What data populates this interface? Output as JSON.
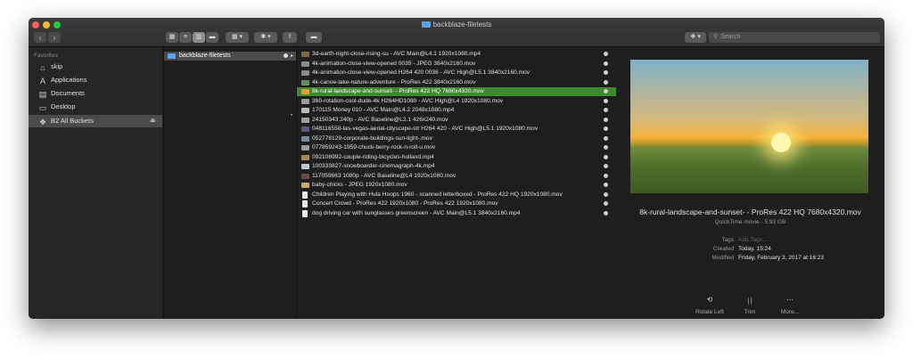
{
  "window": {
    "title": "backblaze-filetests"
  },
  "toolbar": {
    "back": "‹",
    "forward": "›",
    "view_icons": "▦",
    "view_list": "≡",
    "view_columns": "▥",
    "view_gallery": "▬",
    "group": "▦ ▾",
    "action": "✱ ▾",
    "share": "⇪",
    "tags": "▬",
    "dropbox": "❖ ▾",
    "search_placeholder": "Search"
  },
  "sidebar": {
    "heading": "Favorites",
    "items": [
      {
        "label": "skip",
        "icon": "⌂"
      },
      {
        "label": "Applications",
        "icon": "A"
      },
      {
        "label": "Documents",
        "icon": "▤"
      },
      {
        "label": "Desktop",
        "icon": "▭"
      },
      {
        "label": "B2 All Buckets",
        "icon": "❖",
        "eject": "⏏"
      }
    ]
  },
  "column1": {
    "folder": "backblaze-filetests",
    "arrow": "▸"
  },
  "column2_arrow": "▸",
  "files": [
    {
      "name": "3d-earth-night-close-rising-su - AVC Main@L4.1 1920x1080.mp4",
      "thumb": "#7a6a4a"
    },
    {
      "name": "4k-animation-close-view-opened 0035 - JPEG  3840x2160.mov",
      "thumb": "#8a8a8a"
    },
    {
      "name": "4k-animation-close-view-opened H264 420 0036 - AVC High@L5.1 3840x2160.mov",
      "thumb": "#8a8a8a"
    },
    {
      "name": "4k-canoe-lake-nature-adventure - ProRes 422 3840x2160.mov",
      "thumb": "#6a8a6a"
    },
    {
      "name": "8k-rural-landscape-and-sunset- - ProRes 422 HQ 7680x4320.mov",
      "thumb": "#d9a13a"
    },
    {
      "name": "360-rotation-cool-dude-4k H264HD1080 - AVC High@L4 1920x1080.mov",
      "thumb": "#9a9a9a"
    },
    {
      "name": "170115 Money 010 - AVC Main@L4.2 2048x1080.mp4",
      "thumb": "#bbbbbb"
    },
    {
      "name": "24150343 240p - AVC Baseline@L2.1 426x240.mov",
      "thumb": "#a0a0a0"
    },
    {
      "name": "048116558-las-vegas-aerial-cityscape-str H264 420 - AVC High@L5.1 1920x1080.mov",
      "thumb": "#5a5a7a"
    },
    {
      "name": "052778129-corporate-buildings-sun-light-.mov",
      "thumb": "#7a8aa0"
    },
    {
      "name": "077859243-1959-chuck-berry-rock-n-roll-u.mov",
      "thumb": "#9a9a9a"
    },
    {
      "name": "092106992-couple-riding-bicycles-holland.mp4",
      "thumb": "#a08a5a"
    },
    {
      "name": "100333827-snowboarder-cinemagraph-4k.mp4",
      "thumb": "#c0c8d0"
    },
    {
      "name": "117059663 1080p - AVC Baseline@L4 1920x1080.mov",
      "thumb": "#6a4a4a"
    },
    {
      "name": "baby-chicks - JPEG  1920x1080.mov",
      "thumb": "#c0b070"
    },
    {
      "name": "Children Playing with Hula Hoops 1960 - scanned letterboxed - ProRes 422 HQ 1920x1080.mov",
      "thumb": "doc"
    },
    {
      "name": "Concert Crowd - ProRes 422 1920x1080 - ProRes 422 1920x1080.mov",
      "thumb": "doc"
    },
    {
      "name": "dog driving car with sunglasses greenscreen - AVC Main@L5.1 3840x2160.mp4",
      "thumb": "doc"
    }
  ],
  "preview": {
    "name": "8k-rural-landscape-and-sunset- - ProRes 422 HQ 7680x4320.mov",
    "subtitle": "QuickTime movie - 5.93 GB",
    "meta": [
      {
        "key": "Tags",
        "value": "Add Tags…",
        "placeholder": true
      },
      {
        "key": "Created",
        "value": "Today, 15:24"
      },
      {
        "key": "Modified",
        "value": "Friday, February 3, 2017 at 16:23"
      }
    ],
    "actions": [
      {
        "label": "Rotate Left",
        "icon": "⟲"
      },
      {
        "label": "Trim",
        "icon": "⸡⸠"
      },
      {
        "label": "More...",
        "icon": "⋯"
      }
    ]
  }
}
